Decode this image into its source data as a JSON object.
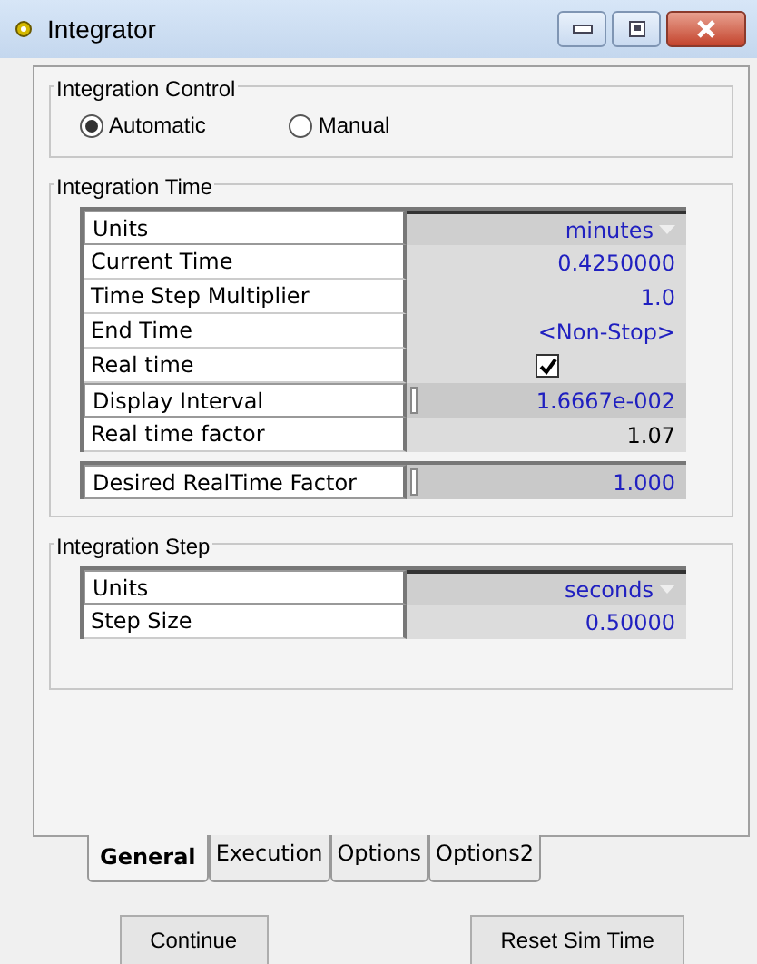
{
  "window": {
    "title": "Integrator"
  },
  "integration_control": {
    "title": "Integration Control",
    "options": [
      {
        "label": "Automatic",
        "selected": true
      },
      {
        "label": "Manual",
        "selected": false
      }
    ]
  },
  "integration_time": {
    "title": "Integration Time",
    "grids": [
      [
        {
          "label": "Units",
          "kind": "dropdown",
          "value": "minutes",
          "readonly": false
        },
        {
          "label": "Current Time",
          "kind": "text",
          "value": "0.4250000",
          "readonly": false
        },
        {
          "label": "Time Step Multiplier",
          "kind": "text",
          "value": "1.0",
          "readonly": false
        },
        {
          "label": "End Time",
          "kind": "text",
          "value": "<Non-Stop>",
          "readonly": false
        },
        {
          "label": "Real time",
          "kind": "checkbox",
          "checked": true
        },
        {
          "label": "Display Interval",
          "kind": "slider",
          "value": "1.6667e-002",
          "readonly": false
        },
        {
          "label": "Real time factor",
          "kind": "text",
          "value": "1.07",
          "readonly": true
        }
      ],
      [
        {
          "label": "Desired RealTime Factor",
          "kind": "slider",
          "value": "1.000",
          "readonly": false
        }
      ]
    ]
  },
  "integration_step": {
    "title": "Integration Step",
    "grids": [
      [
        {
          "label": "Units",
          "kind": "dropdown",
          "value": "seconds",
          "readonly": false
        },
        {
          "label": "Step Size",
          "kind": "text",
          "value": "0.50000",
          "readonly": false
        }
      ]
    ]
  },
  "tabs": [
    {
      "label": "General",
      "selected": true
    },
    {
      "label": "Execution",
      "selected": false
    },
    {
      "label": "Options",
      "selected": false
    },
    {
      "label": "Options2",
      "selected": false
    }
  ],
  "buttons": [
    "Continue",
    "Reset Sim Time"
  ]
}
